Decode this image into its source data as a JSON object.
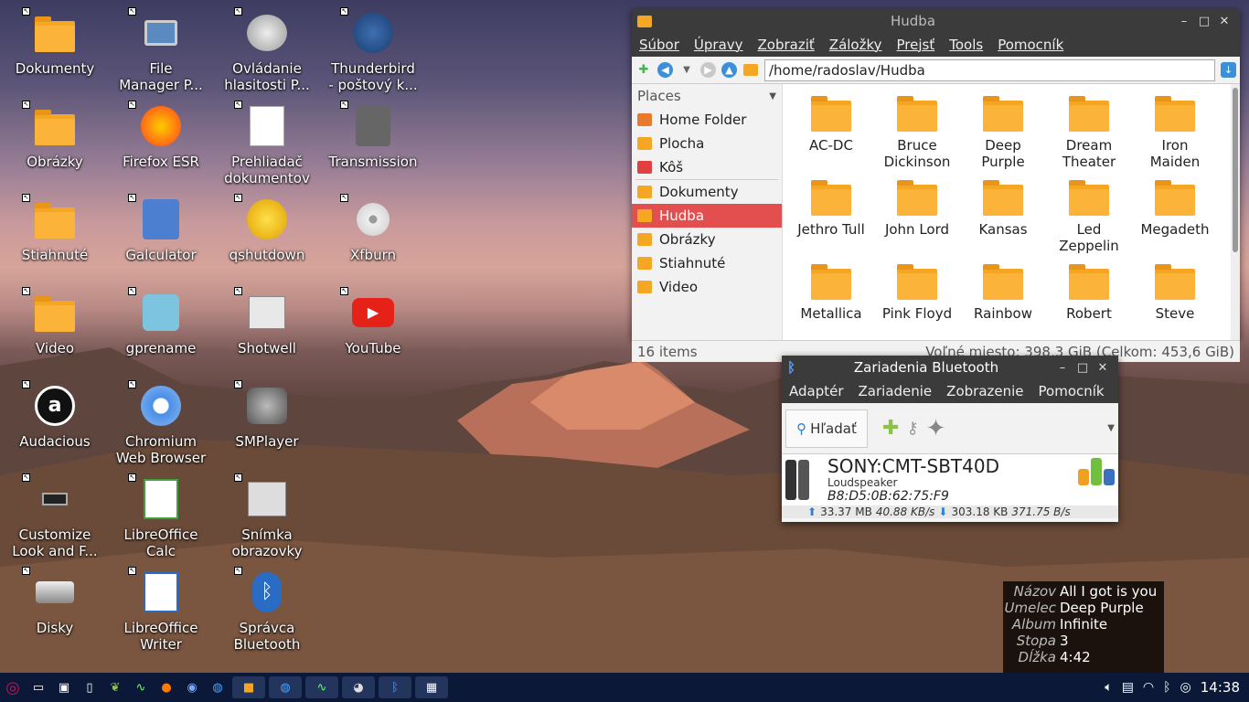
{
  "desktop": {
    "icons": [
      {
        "label": "Dokumenty",
        "icon": "folder-icon"
      },
      {
        "label": "File\nManager P...",
        "icon": "file-manager-icon"
      },
      {
        "label": "Ovládanie\nhlasitosti P...",
        "icon": "volume-control-icon"
      },
      {
        "label": "Thunderbird\n- poštový k...",
        "icon": "thunderbird-icon"
      },
      {
        "label": "Obrázky",
        "icon": "folder-icon"
      },
      {
        "label": "Firefox ESR",
        "icon": "firefox-icon"
      },
      {
        "label": "Prehliadač\ndokumentov",
        "icon": "document-viewer-icon"
      },
      {
        "label": "Transmission",
        "icon": "transmission-icon"
      },
      {
        "label": "Stiahnuté",
        "icon": "folder-icon"
      },
      {
        "label": "Galculator",
        "icon": "calculator-icon"
      },
      {
        "label": "qshutdown",
        "icon": "qshutdown-icon"
      },
      {
        "label": "Xfburn",
        "icon": "disc-icon"
      },
      {
        "label": "Video",
        "icon": "folder-icon"
      },
      {
        "label": "gprename",
        "icon": "gprename-icon"
      },
      {
        "label": "Shotwell",
        "icon": "shotwell-icon"
      },
      {
        "label": "YouTube",
        "icon": "youtube-icon"
      },
      {
        "label": "Audacious",
        "icon": "audacious-icon"
      },
      {
        "label": "Chromium\nWeb Browser",
        "icon": "chromium-icon"
      },
      {
        "label": "SMPlayer",
        "icon": "smplayer-icon"
      },
      {
        "label": "Customize\nLook and F...",
        "icon": "customize-icon"
      },
      {
        "label": "LibreOffice\nCalc",
        "icon": "libreoffice-calc-icon"
      },
      {
        "label": "Snímka\nobrazovky",
        "icon": "screenshot-icon"
      },
      {
        "label": "Disky",
        "icon": "disks-icon"
      },
      {
        "label": "LibreOffice\nWriter",
        "icon": "libreoffice-writer-icon"
      },
      {
        "label": "Správca\nBluetooth",
        "icon": "bluetooth-icon"
      }
    ]
  },
  "file_manager": {
    "title": "Hudba",
    "menu": [
      "Súbor",
      "Úpravy",
      "Zobraziť",
      "Záložky",
      "Prejsť",
      "Tools",
      "Pomocník"
    ],
    "path": "/home/radoslav/Hudba",
    "places_header": "Places",
    "places": [
      {
        "label": "Home Folder",
        "icon": "home-icon"
      },
      {
        "label": "Plocha",
        "icon": "desktop-icon"
      },
      {
        "label": "Kôš",
        "icon": "trash-icon"
      },
      {
        "label": "Dokumenty",
        "icon": "folder-icon"
      },
      {
        "label": "Hudba",
        "icon": "music-folder-icon",
        "selected": true
      },
      {
        "label": "Obrázky",
        "icon": "pictures-folder-icon"
      },
      {
        "label": "Stiahnuté",
        "icon": "download-folder-icon"
      },
      {
        "label": "Video",
        "icon": "video-folder-icon"
      }
    ],
    "files": [
      "AC-DC",
      "Bruce\nDickinson",
      "Deep\nPurple",
      "Dream\nTheater",
      "Iron\nMaiden",
      "Jethro Tull",
      "John Lord",
      "Kansas",
      "Led\nZeppelin",
      "Megadeth",
      "Metallica",
      "Pink Floyd",
      "Rainbow",
      "Robert",
      "Steve"
    ],
    "status_items": "16 items",
    "status_space": "Voľné miesto: 398,3 GiB (Celkom: 453,6 GiB)"
  },
  "bluetooth": {
    "title": "Zariadenia Bluetooth",
    "menu": [
      "Adaptér",
      "Zariadenie",
      "Zobrazenie",
      "Pomocník"
    ],
    "search_label": "Hľadať",
    "device": {
      "name": "SONY:CMT-SBT40D",
      "type": "Loudspeaker",
      "mac": "B8:D5:0B:62:75:F9"
    },
    "upload": "33.37 MB",
    "upload_rate": "40.88 KB/s",
    "download": "303.18 KB",
    "download_rate": "371.75 B/s"
  },
  "track_info": {
    "rows": [
      {
        "key": "Názov",
        "value": "All I got is you"
      },
      {
        "key": "Umelec",
        "value": "Deep Purple"
      },
      {
        "key": "Album",
        "value": "Infinite"
      },
      {
        "key": "Stopa",
        "value": "3"
      },
      {
        "key": "Dĺžka",
        "value": "4:42"
      }
    ]
  },
  "taskbar": {
    "clock": "14:38",
    "accent": "#0c1838"
  }
}
